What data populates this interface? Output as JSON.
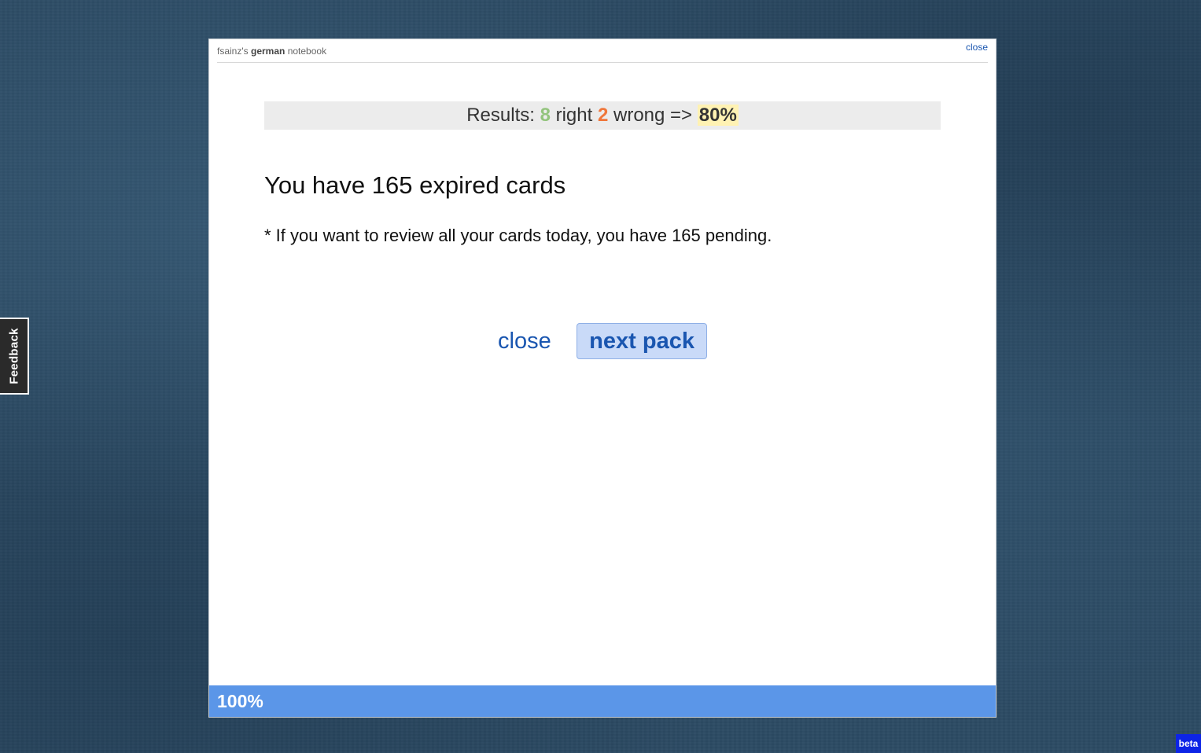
{
  "feedback_tab": {
    "label": "Feedback"
  },
  "modal": {
    "header": {
      "owner": "fsainz's",
      "language": "german",
      "suffix": "notebook",
      "close_label": "close"
    },
    "results": {
      "prefix": "Results:",
      "right_count": "8",
      "right_label": "right",
      "wrong_count": "2",
      "wrong_label": "wrong =>",
      "percent": "80%"
    },
    "heading": "You have 165 expired cards",
    "note": "* If you want to review all your cards today, you have 165 pending.",
    "actions": {
      "close_label": "close",
      "next_label": "next pack"
    },
    "progress": {
      "label": "100%",
      "value": 1.0
    }
  },
  "beta_badge": "beta",
  "colors": {
    "accent": "#1a56b0",
    "right": "#93c47d",
    "wrong": "#f0763a",
    "progress": "#5b96e8",
    "highlight": "#fff2b3"
  }
}
